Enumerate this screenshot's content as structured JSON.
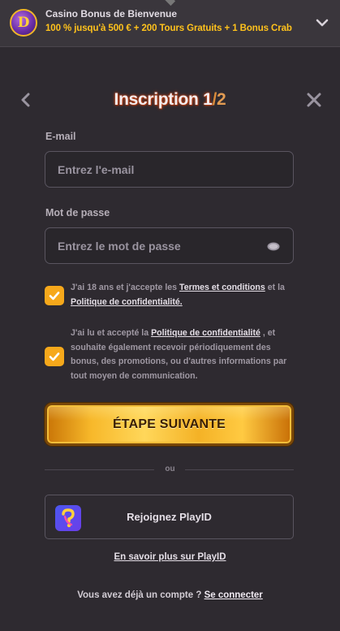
{
  "banner": {
    "logo_letter": "D",
    "title": "Casino Bonus de Bienvenue",
    "subtitle": "100 % jusqu'à 500 € + 200 Tours Gratuits + 1 Bonus Crab"
  },
  "header": {
    "title_main": "Inscription 1",
    "title_slash": "/",
    "title_total": "2"
  },
  "form": {
    "email_label": "E-mail",
    "email_placeholder": "Entrez l'e-mail",
    "password_label": "Mot de passe",
    "password_placeholder": "Entrez le mot de passe"
  },
  "consents": [
    {
      "checked": true,
      "text_before": "J'ai 18 ans et j'accepte les ",
      "link1": "Termes et conditions",
      "text_middle": " et la ",
      "link2": "Politique de confidentialité."
    },
    {
      "checked": true,
      "text_before": "J'ai lu et accepté la ",
      "link1": "Politique de confidentialité",
      "text_after": " , et souhaite également recevoir périodiquement des bonus, des promotions, ou d'autres informations par tout moyen de communication."
    }
  ],
  "cta": {
    "label": "ÉTAPE SUIVANTE"
  },
  "divider": {
    "text": "ou"
  },
  "playid": {
    "button_label": "Rejoignez PlayID",
    "learn_more": "En savoir plus sur PlayID"
  },
  "footer": {
    "question": "Vous avez déjà un compte ? ",
    "login_link": "Se connecter"
  },
  "colors": {
    "background": "#2e2a30",
    "accent": "#f6a81b",
    "banner_highlight": "#ffc21c"
  }
}
